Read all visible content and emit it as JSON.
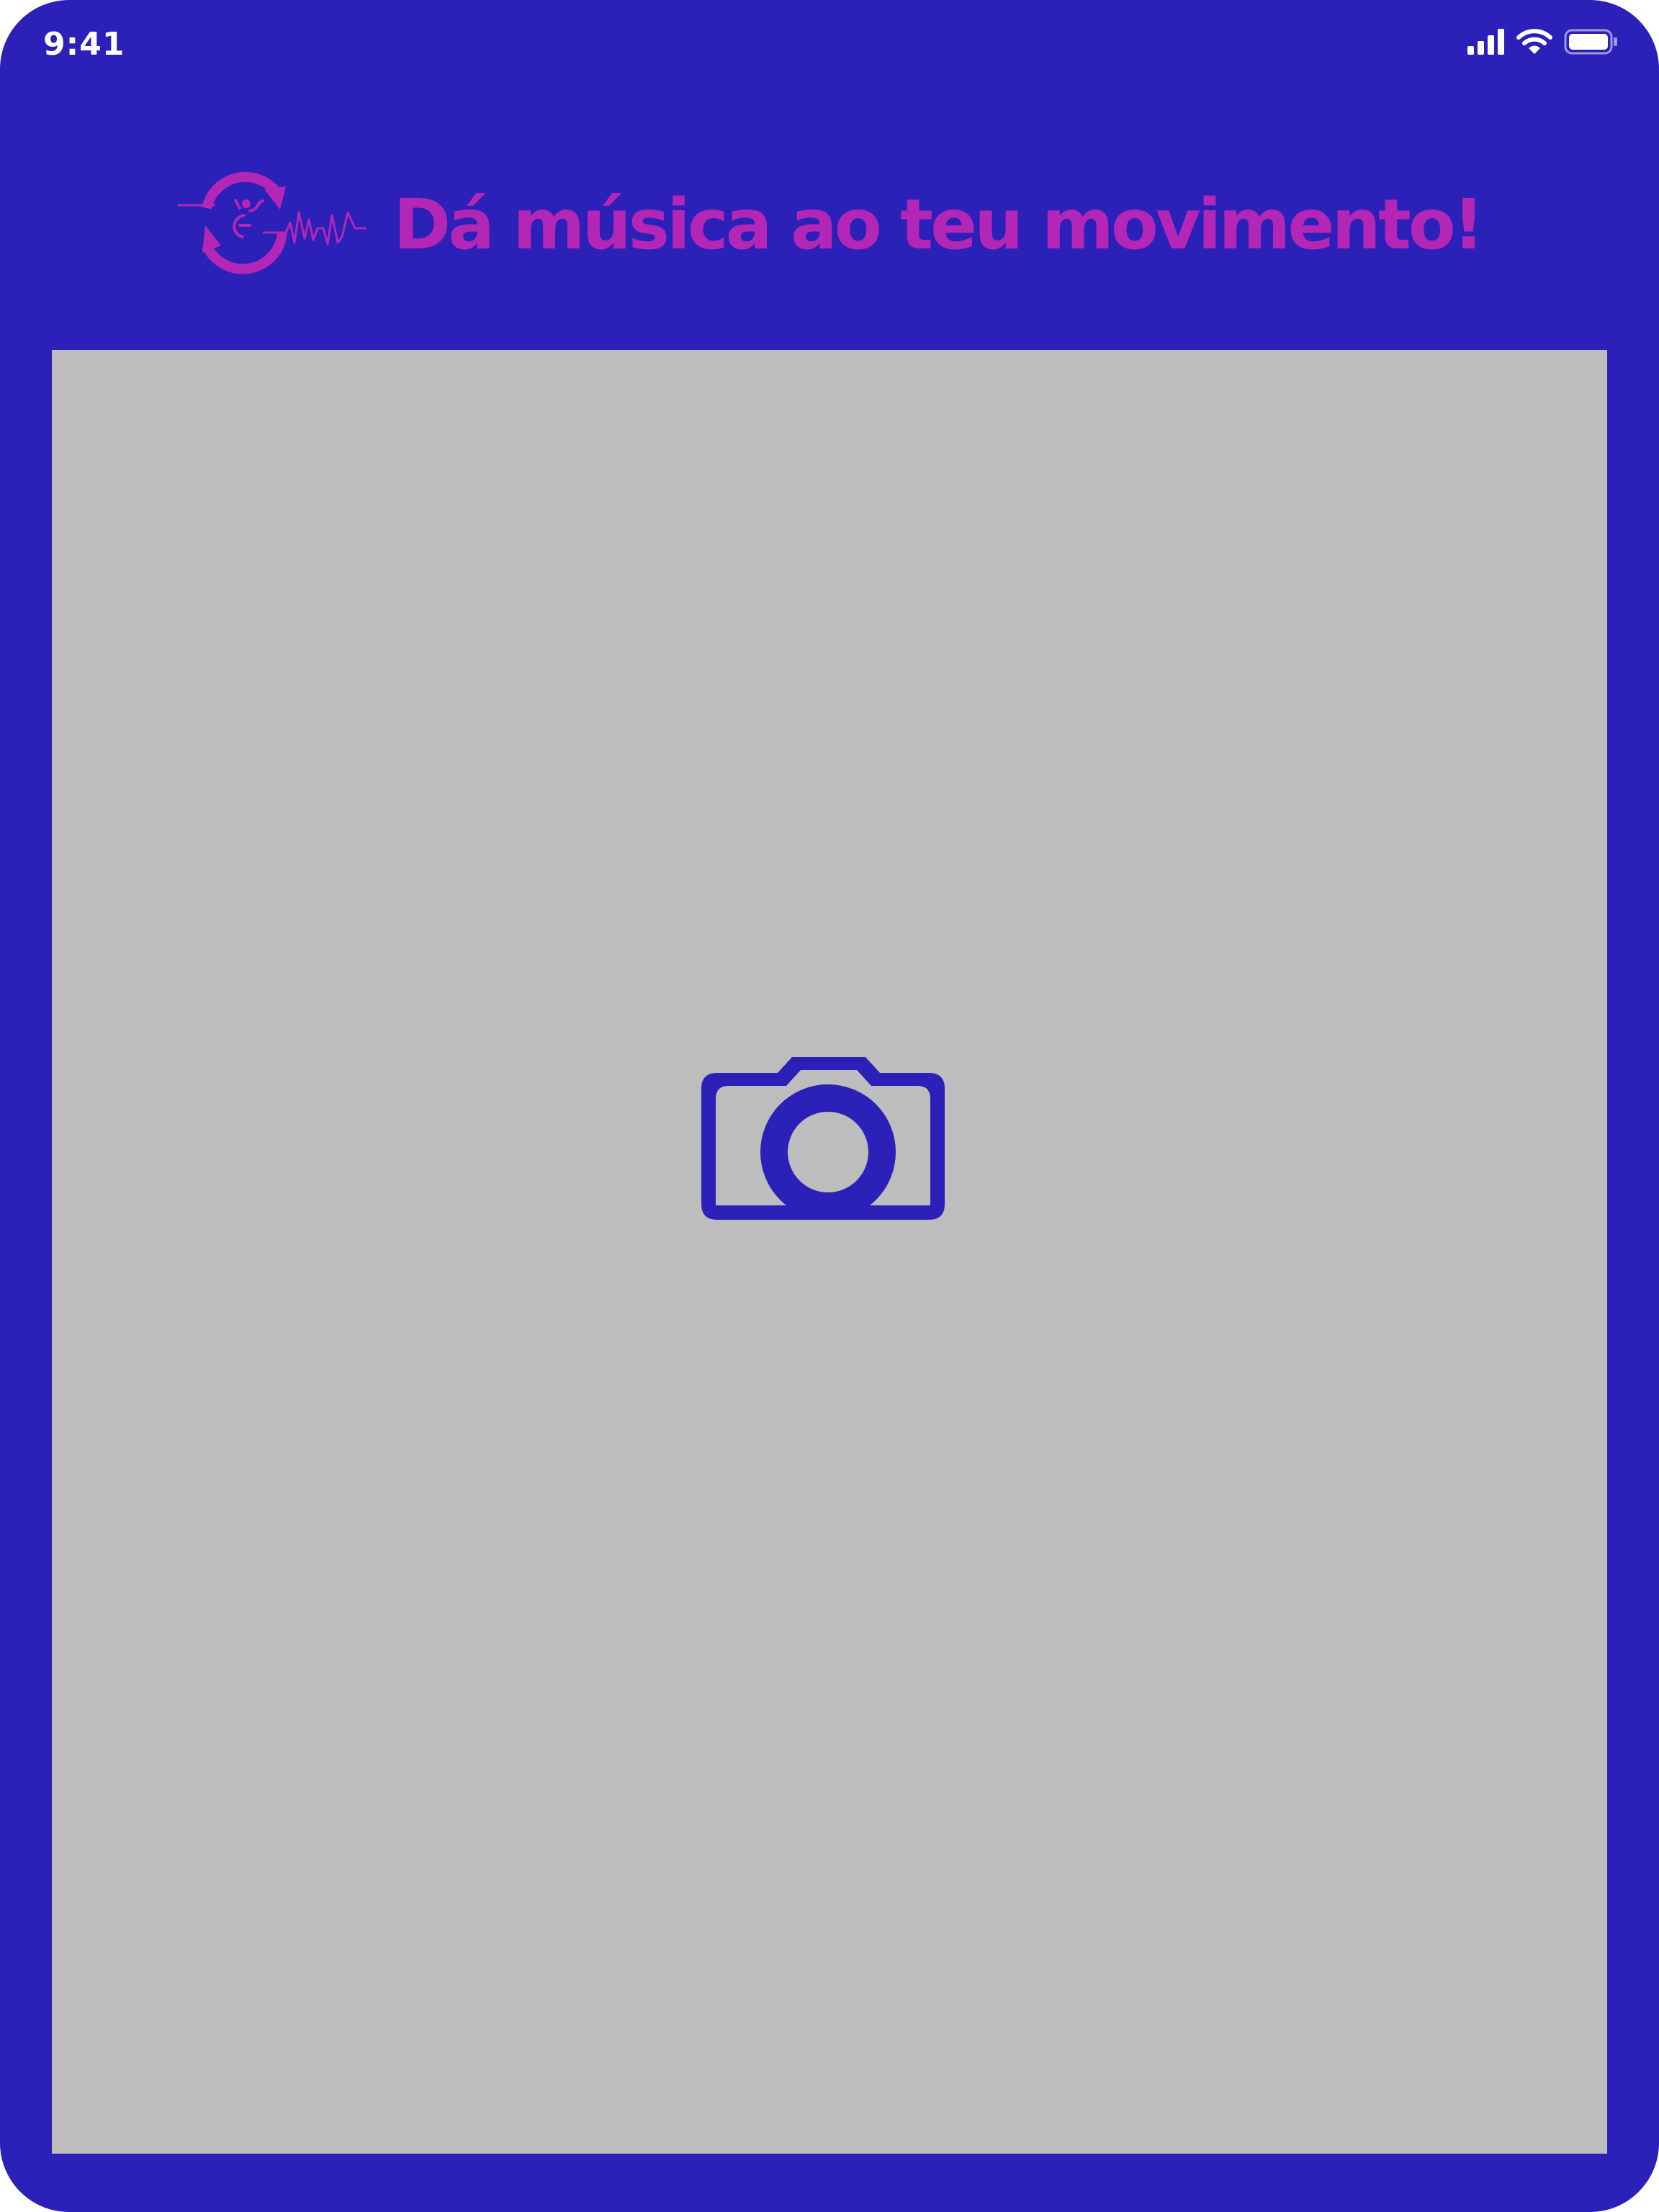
{
  "status_bar": {
    "time": "9:41",
    "icons": [
      "cellular-signal-icon",
      "wifi-icon",
      "battery-icon"
    ]
  },
  "header": {
    "logo_icon": "movement-music-logo-icon",
    "tagline": "Dá música ao teu movimento!"
  },
  "camera": {
    "icon": "camera-icon",
    "preview_color": "#bdbdbd"
  },
  "colors": {
    "background": "#2b20b8",
    "accent": "#b426b6",
    "preview": "#bdbdbd"
  }
}
